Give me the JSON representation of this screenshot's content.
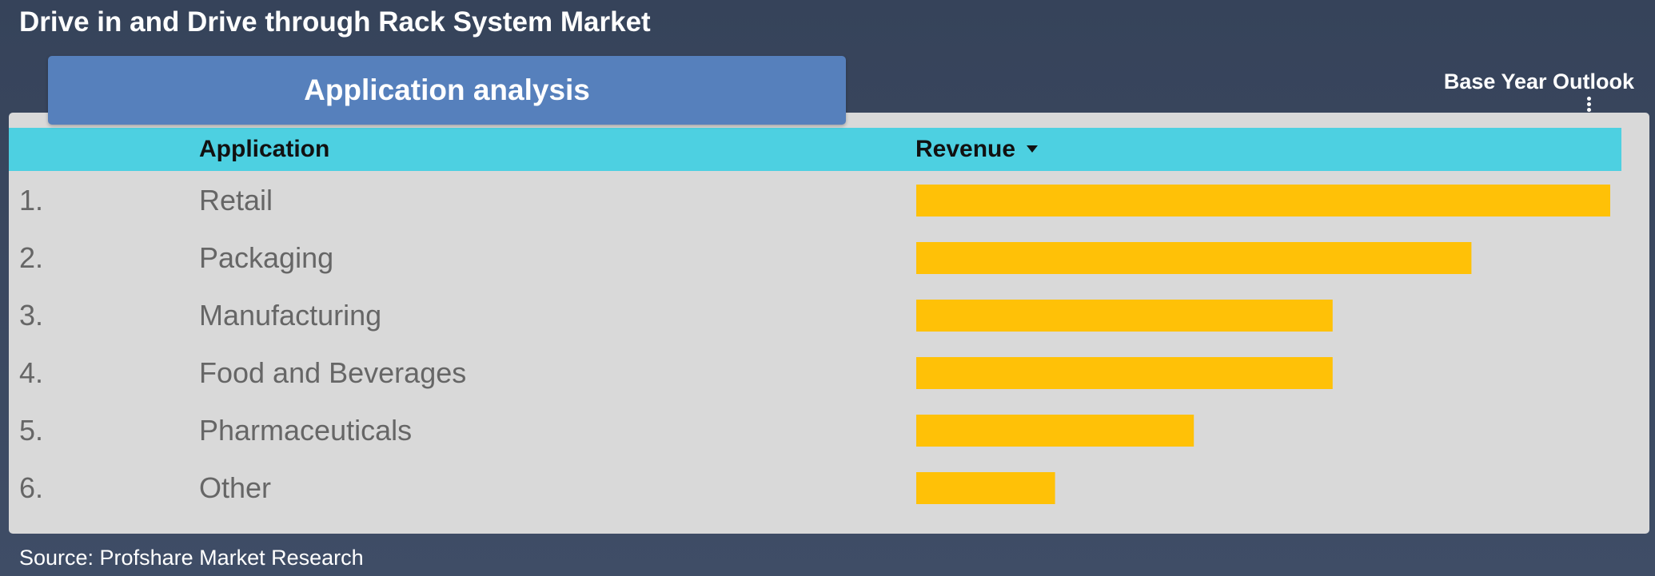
{
  "page": {
    "title": "Drive in and Drive through Rack System Market",
    "tab_label": "Application analysis",
    "outlook_label": "Base Year Outlook",
    "source": "Source: Profshare Market Research"
  },
  "colors": {
    "background": "#3a475e",
    "panel": "#d9d9d9",
    "tab": "#5680bc",
    "header": "#4dd0e1",
    "bar": "#ffc107",
    "row_text": "#666666"
  },
  "icons": {
    "more": "vertical-ellipsis-icon",
    "sort": "caret-down-icon"
  },
  "chart_data": {
    "type": "bar",
    "orientation": "horizontal",
    "header": {
      "category": "Application",
      "value": "Revenue"
    },
    "sorted": "descending",
    "value_scale": "relative",
    "grid": false,
    "ranks": [
      "1.",
      "2.",
      "3.",
      "4.",
      "5.",
      "6."
    ],
    "categories": [
      "Retail",
      "Packaging",
      "Manufacturing",
      "Food and Beverages",
      "Pharmaceuticals",
      "Other"
    ],
    "values": [
      100,
      80,
      60,
      60,
      40,
      20
    ],
    "xlim": [
      0,
      100
    ]
  }
}
